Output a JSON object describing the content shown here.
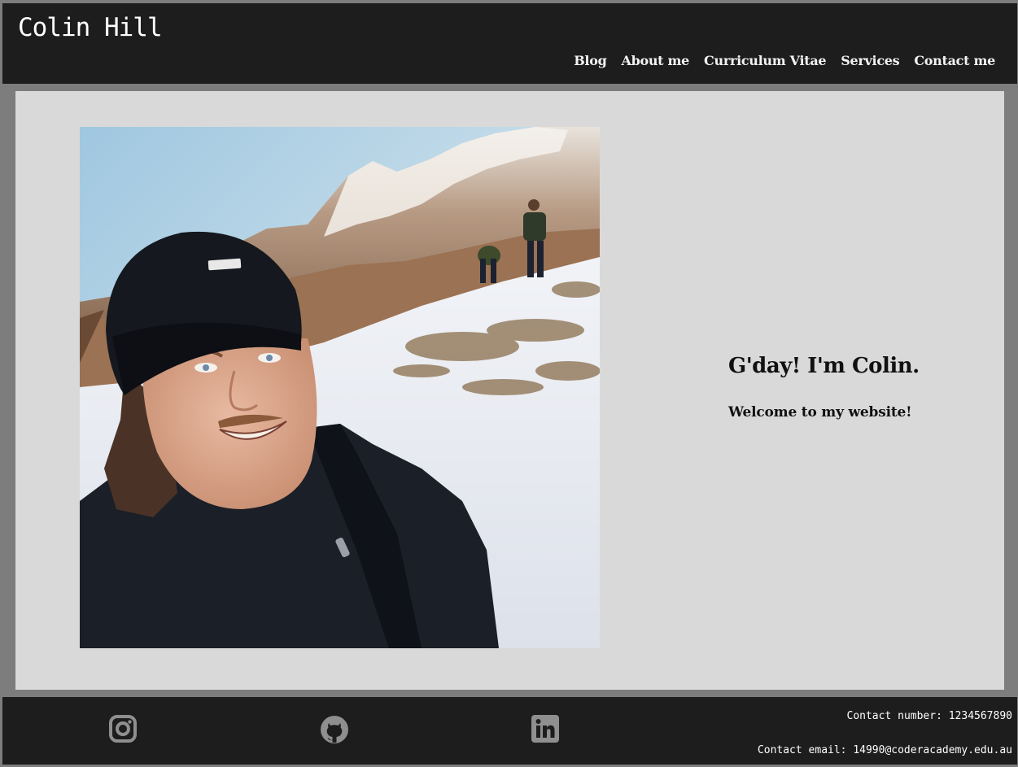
{
  "header": {
    "title": "Colin Hill",
    "nav": [
      {
        "label": "Blog"
      },
      {
        "label": "About me"
      },
      {
        "label": "Curriculum Vitae"
      },
      {
        "label": "Services"
      },
      {
        "label": "Contact me"
      }
    ]
  },
  "main": {
    "greeting": "G'day! I'm Colin.",
    "welcome": "Welcome to my website!",
    "photo_icon": "profile-photo"
  },
  "footer": {
    "social": [
      {
        "icon": "instagram-icon"
      },
      {
        "icon": "github-icon"
      },
      {
        "icon": "linkedin-icon"
      }
    ],
    "contact_number": "Contact number: 1234567890",
    "contact_email": "Contact email: 14990@coderacademy.edu.au"
  },
  "colors": {
    "page_background": "#7d7d7d",
    "bar_background": "#1d1d1d",
    "panel_background": "#d9d9d9",
    "icon_color": "#8f8f8f"
  }
}
